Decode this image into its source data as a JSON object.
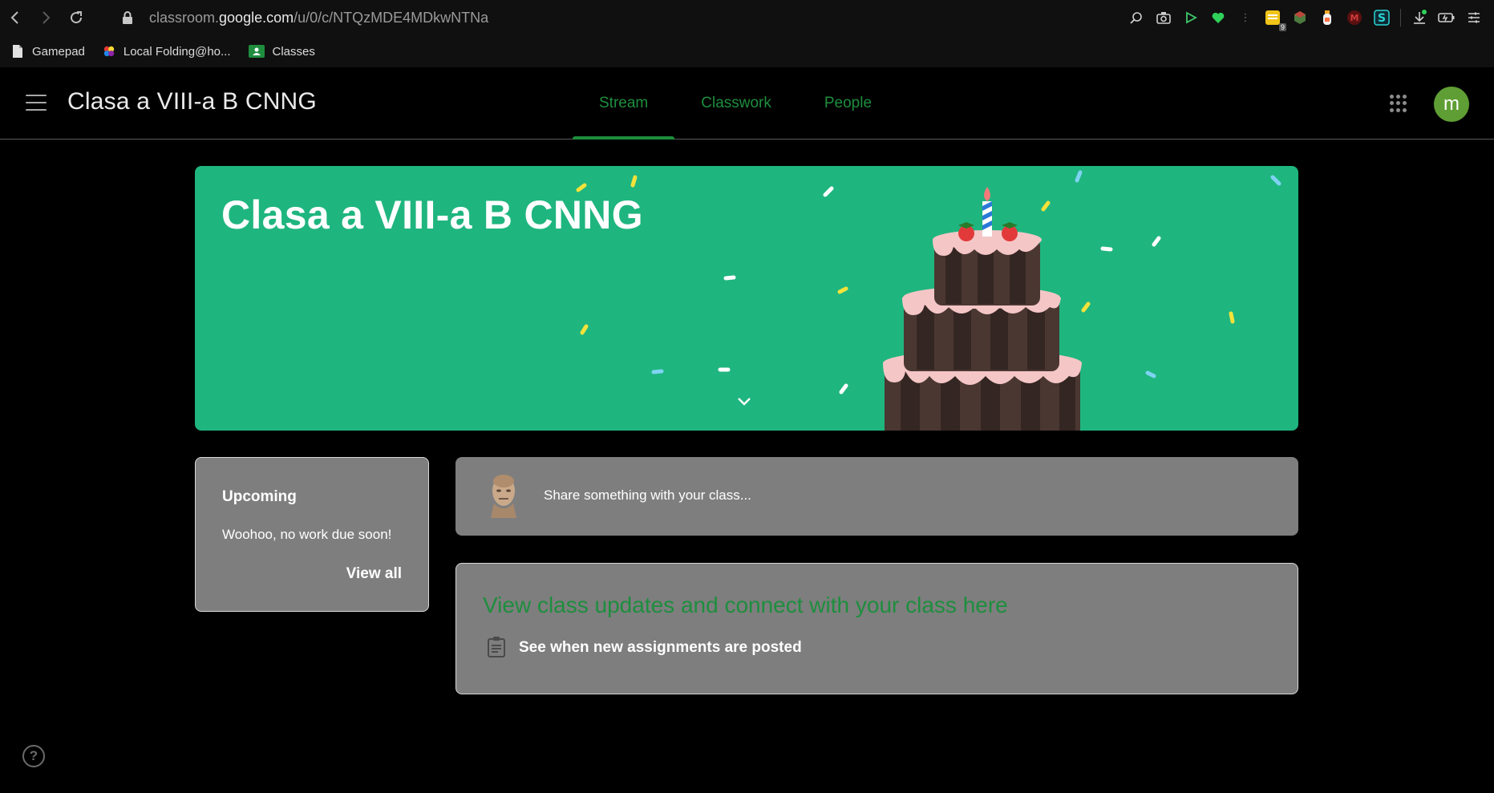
{
  "browser": {
    "url_prefix": "classroom.",
    "url_domain": "google.com",
    "url_path": "/u/0/c/NTQzMDE4MDkwNTNa",
    "bookmarks": [
      {
        "label": "Gamepad",
        "icon": "document-icon"
      },
      {
        "label": "Local Folding@ho...",
        "icon": "folding-icon"
      },
      {
        "label": "Classes",
        "icon": "classroom-icon"
      }
    ],
    "extension_badge": "9"
  },
  "header": {
    "title": "Clasa a VIII-a B CNNG",
    "tabs": [
      "Stream",
      "Classwork",
      "People"
    ],
    "active_tab": "Stream",
    "avatar_letter": "m"
  },
  "banner": {
    "title": "Clasa a VIII-a B CNNG",
    "theme": "birthday-cake"
  },
  "upcoming": {
    "title": "Upcoming",
    "message": "Woohoo, no work due soon!",
    "view_all": "View all"
  },
  "share": {
    "placeholder": "Share something with your class..."
  },
  "updates": {
    "heading": "View class updates and connect with your class here",
    "item": "See when new assignments are posted"
  },
  "help": {
    "symbol": "?"
  },
  "colors": {
    "accent": "#1e8e3e",
    "banner_bg": "#1fb57f",
    "card_bg": "#7e7e7e",
    "avatar_bg": "#5f9e34"
  }
}
